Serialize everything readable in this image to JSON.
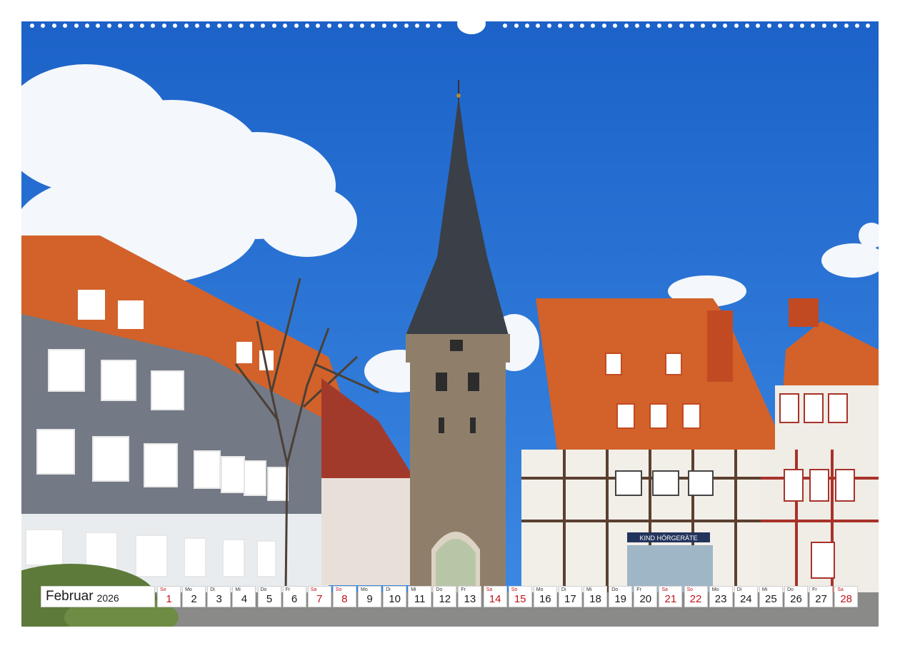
{
  "calendar": {
    "month": "Februar",
    "year": "2026",
    "days": [
      {
        "dow": "So",
        "num": "1",
        "weekend": true
      },
      {
        "dow": "Mo",
        "num": "2",
        "weekend": false
      },
      {
        "dow": "Di",
        "num": "3",
        "weekend": false
      },
      {
        "dow": "Mi",
        "num": "4",
        "weekend": false
      },
      {
        "dow": "Do",
        "num": "5",
        "weekend": false
      },
      {
        "dow": "Fr",
        "num": "6",
        "weekend": false
      },
      {
        "dow": "Sa",
        "num": "7",
        "weekend": true
      },
      {
        "dow": "So",
        "num": "8",
        "weekend": true
      },
      {
        "dow": "Mo",
        "num": "9",
        "weekend": false
      },
      {
        "dow": "Di",
        "num": "10",
        "weekend": false
      },
      {
        "dow": "Mi",
        "num": "11",
        "weekend": false
      },
      {
        "dow": "Do",
        "num": "12",
        "weekend": false
      },
      {
        "dow": "Fr",
        "num": "13",
        "weekend": false
      },
      {
        "dow": "Sa",
        "num": "14",
        "weekend": true
      },
      {
        "dow": "So",
        "num": "15",
        "weekend": true
      },
      {
        "dow": "Mo",
        "num": "16",
        "weekend": false
      },
      {
        "dow": "Di",
        "num": "17",
        "weekend": false
      },
      {
        "dow": "Mi",
        "num": "18",
        "weekend": false
      },
      {
        "dow": "Do",
        "num": "19",
        "weekend": false
      },
      {
        "dow": "Fr",
        "num": "20",
        "weekend": false
      },
      {
        "dow": "Sa",
        "num": "21",
        "weekend": true
      },
      {
        "dow": "So",
        "num": "22",
        "weekend": true
      },
      {
        "dow": "Mo",
        "num": "23",
        "weekend": false
      },
      {
        "dow": "Di",
        "num": "24",
        "weekend": false
      },
      {
        "dow": "Mi",
        "num": "25",
        "weekend": false
      },
      {
        "dow": "Do",
        "num": "26",
        "weekend": false
      },
      {
        "dow": "Fr",
        "num": "27",
        "weekend": false
      },
      {
        "dow": "Sa",
        "num": "28",
        "weekend": true
      }
    ]
  },
  "photo": {
    "shop_sign": "KIND HÖRGERÄTE",
    "colors": {
      "sky": "#1f6fd6",
      "roof": "#d2622a",
      "slate": "#6f7480",
      "stone": "#8f7f6a",
      "spire": "#3b3f47",
      "weekend": "#c0141c"
    }
  }
}
